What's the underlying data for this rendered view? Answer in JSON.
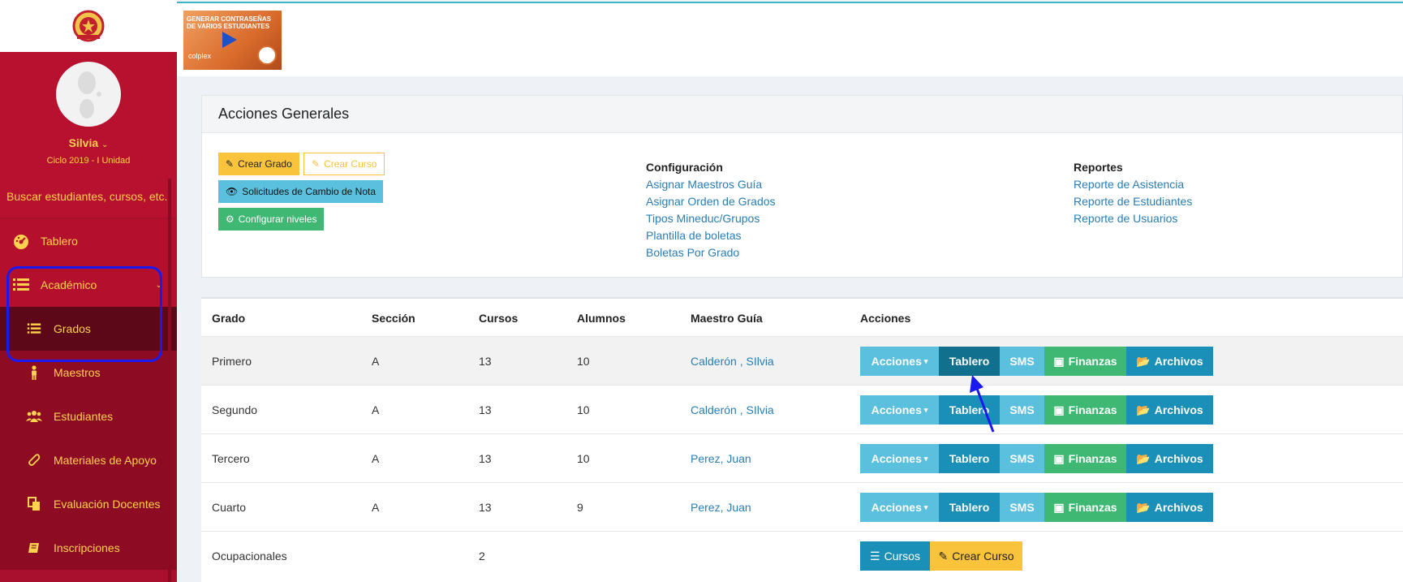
{
  "header": {
    "video": {
      "title_line1": "GENERAR CONTRASEÑAS",
      "title_line2": "DE VARIOS ESTUDIANTES",
      "brand": "colplex"
    }
  },
  "sidebar": {
    "user_name": "Silvia",
    "cycle": "Ciclo 2019 - I Unidad",
    "search_label": "Buscar estudiantes, cursos, etc..",
    "items": [
      {
        "label": "Tablero",
        "icon": "dashboard-icon"
      },
      {
        "label": "Académico",
        "icon": "list-icon"
      },
      {
        "label": "Grados",
        "icon": "list-icon"
      },
      {
        "label": "Maestros",
        "icon": "person-icon"
      },
      {
        "label": "Estudiantes",
        "icon": "users-icon"
      },
      {
        "label": "Materiales de Apoyo",
        "icon": "paperclip-icon"
      },
      {
        "label": "Evaluación Docentes",
        "icon": "copy-icon"
      },
      {
        "label": "Inscripciones",
        "icon": "book-icon"
      }
    ],
    "colors": {
      "bg": "#a8102e",
      "text": "#ffd24d"
    }
  },
  "panel": {
    "title": "Acciones Generales",
    "buttons": {
      "crear_grado": "Crear Grado",
      "crear_curso": "Crear Curso",
      "solicitudes": "Solicitudes de Cambio de Nota",
      "configurar_niveles": "Configurar niveles"
    },
    "config": {
      "title": "Configuración",
      "links": [
        "Asignar Maestros Guía",
        "Asignar Orden de Grados",
        "Tipos Mineduc/Grupos",
        "Plantilla de boletas",
        "Boletas Por Grado"
      ]
    },
    "reportes": {
      "title": "Reportes",
      "links": [
        "Reporte de Asistencia",
        "Reporte de Estudiantes",
        "Reporte de Usuarios"
      ]
    }
  },
  "table": {
    "headers": [
      "Grado",
      "Sección",
      "Cursos",
      "Alumnos",
      "Maestro Guía",
      "Acciones"
    ],
    "rows": [
      {
        "grado": "Primero",
        "seccion": "A",
        "cursos": "13",
        "alumnos": "10",
        "maestro": "Calderón , SIlvia"
      },
      {
        "grado": "Segundo",
        "seccion": "A",
        "cursos": "13",
        "alumnos": "10",
        "maestro": "Calderón , SIlvia"
      },
      {
        "grado": "Tercero",
        "seccion": "A",
        "cursos": "13",
        "alumnos": "10",
        "maestro": "Perez, Juan"
      },
      {
        "grado": "Cuarto",
        "seccion": "A",
        "cursos": "13",
        "alumnos": "9",
        "maestro": "Perez, Juan"
      },
      {
        "grado": "Ocupacionales",
        "seccion": "",
        "cursos": "2",
        "alumnos": "",
        "maestro": ""
      }
    ],
    "actions": {
      "acciones": "Acciones",
      "tablero": "Tablero",
      "sms": "SMS",
      "finanzas": "Finanzas",
      "archivos": "Archivos",
      "cursos": "Cursos",
      "crear_curso": "Crear Curso"
    }
  }
}
